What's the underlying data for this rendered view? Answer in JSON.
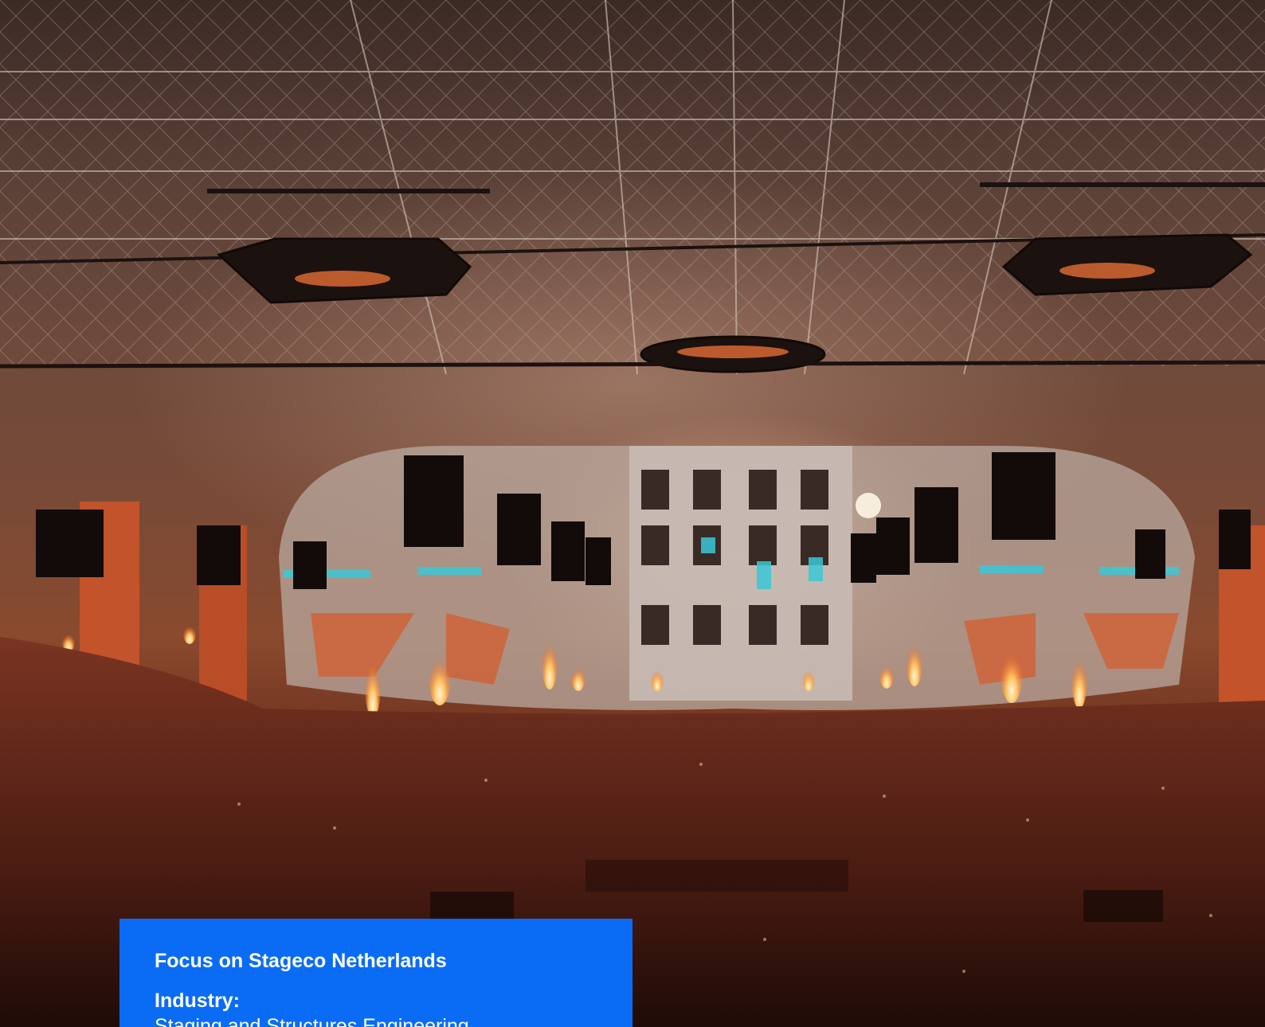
{
  "hero": {
    "image_alt": "Concert arena stage with truss rigging, line-array speakers, pyrotechnic flames and a large crowd",
    "palette": {
      "accent_blue": "#0a6cf5",
      "flame": "#ffb347",
      "screen_cyan": "#39c8d6"
    }
  },
  "card": {
    "title": "Focus on Stageco Netherlands",
    "industry_label": "Industry:",
    "industry_value": "Staging and Structures Engineering"
  }
}
